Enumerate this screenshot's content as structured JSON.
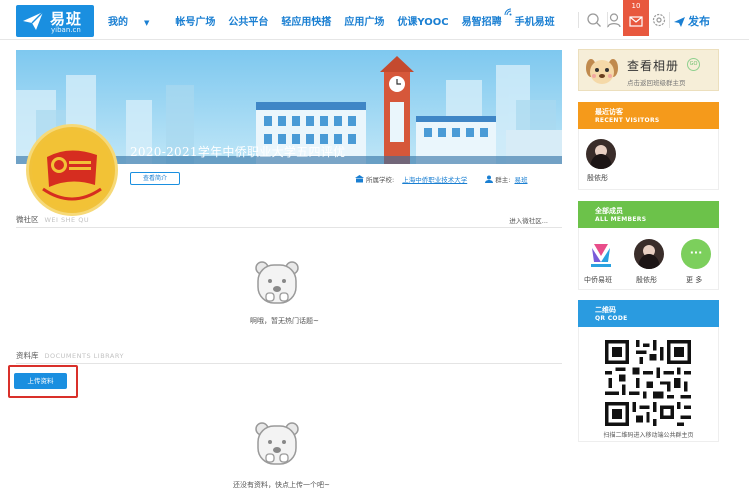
{
  "logo": {
    "name": "易班",
    "sub": "yiban.cn"
  },
  "nav": {
    "items": [
      {
        "label": "我的",
        "caret": "▼"
      },
      {
        "label": "帐号广场"
      },
      {
        "label": "公共平台"
      },
      {
        "label": "轻应用快搭"
      },
      {
        "label": "应用广场"
      },
      {
        "label": "优课YOOC"
      },
      {
        "label": "易智招聘"
      },
      {
        "label": "手机易班"
      }
    ],
    "message_count": "10",
    "publish_label": "发布"
  },
  "banner": {
    "title": "2020-2021学年中侨职业大学五四评优",
    "intro_button": "查看简介",
    "school_label": "所属学校:",
    "school_name": "上海中侨职业技术大学",
    "owner_label": "群主:",
    "owner_name": "易班"
  },
  "community": {
    "title": "微社区",
    "title_en": "WEI SHE QU",
    "more": "进入微社区...",
    "empty_text": "啊哦，暂无热门话题~"
  },
  "library": {
    "title": "资料库",
    "title_en": "DOCUMENTS LIBRARY",
    "upload_button": "上传资料",
    "empty_text": "还没有资料，快点上传一个吧~"
  },
  "sidebar": {
    "album_title": "查看相册",
    "album_sub": "点击返回班级群主页",
    "album_badge": "GO",
    "visitors": {
      "title": "最近访客",
      "title_en": "RECENT VISITORS",
      "people": [
        "殷依彤"
      ]
    },
    "members": {
      "title": "全部成员",
      "title_en": "ALL MEMBERS",
      "people": [
        "中侨易班",
        "殷依彤"
      ],
      "more_label": "更 多",
      "more_icon": "···"
    },
    "qr": {
      "title": "二维码",
      "title_en": "QR CODE",
      "caption": "扫描二维码进入移动端公共群主页"
    }
  },
  "colors": {
    "brand_blue": "#1a8fe0",
    "nav_text": "#1a7fd2",
    "message_red": "#e8583e",
    "visitors_orange": "#f59a1b",
    "members_green": "#6cc24a",
    "qr_blue": "#2a9be0",
    "highlight_red": "#d9302a"
  }
}
